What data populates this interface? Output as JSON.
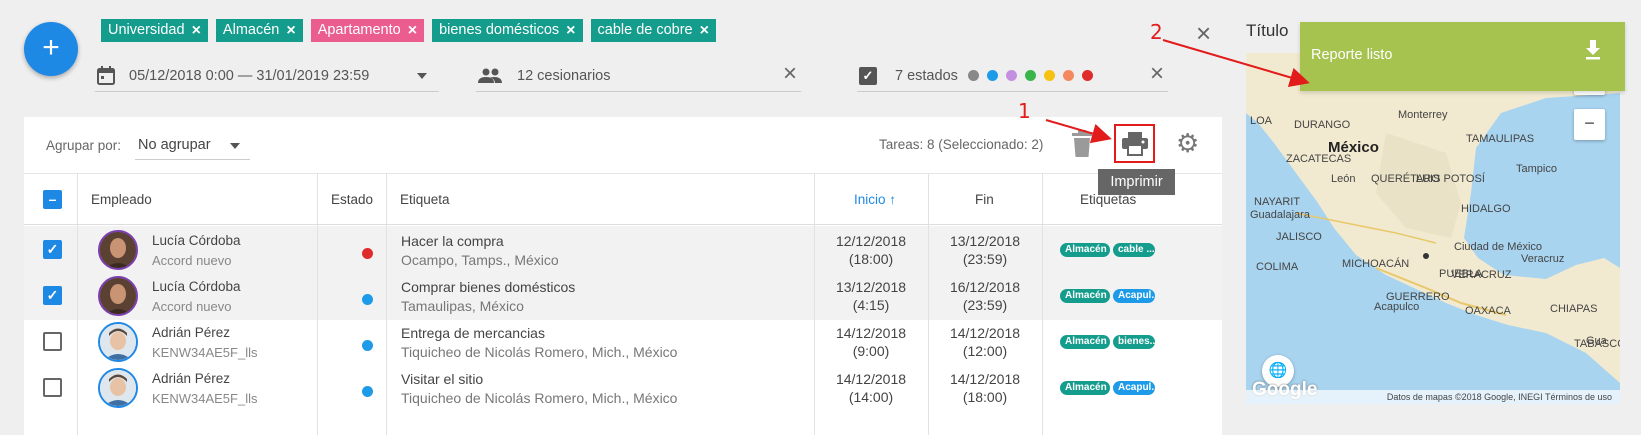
{
  "fab_label": "+",
  "filter_tags": [
    {
      "label": "Universidad",
      "color": "#149c8c"
    },
    {
      "label": "Almacén",
      "color": "#149c8c"
    },
    {
      "label": "Apartamento",
      "color": "#ea5d8e"
    },
    {
      "label": "bienes domésticos",
      "color": "#149c8c"
    },
    {
      "label": "cable de cobre",
      "color": "#149c8c"
    }
  ],
  "filters": {
    "date_range": "05/12/2018 0:00 — 31/01/2019 23:59",
    "assignees": "12 cesionarios",
    "states": "7 estados",
    "state_colors": [
      "#888888",
      "#1e9be8",
      "#c390e0",
      "#39b54a",
      "#f5c213",
      "#f4895f",
      "#e02b2b"
    ]
  },
  "toolbar": {
    "group_label": "Agrupar por:",
    "group_value": "No agrupar",
    "task_count": "Tareas: 8 (Seleccionado: 2)",
    "print_tooltip": "Imprimir"
  },
  "table": {
    "headers": {
      "employee": "Empleado",
      "state": "Estado",
      "label": "Etiqueta",
      "start": "Inicio",
      "end": "Fin",
      "tags": "Etiquetas"
    },
    "rows": [
      {
        "selected": true,
        "avatar": "f",
        "name": "Lucía Córdoba",
        "sub": "Accord nuevo",
        "state_color": "#e02b2b",
        "title": "Hacer la compra",
        "place": "Ocampo, Tamps., México",
        "start_date": "12/12/2018",
        "start_time": "(18:00)",
        "end_date": "13/12/2018",
        "end_time": "(23:59)",
        "chips": [
          {
            "label": "Almacén",
            "color": "#149c8c"
          },
          {
            "label": "cable ...",
            "color": "#149c8c"
          }
        ]
      },
      {
        "selected": true,
        "avatar": "f",
        "name": "Lucía Córdoba",
        "sub": "Accord nuevo",
        "state_color": "#1e9be8",
        "title": "Comprar bienes domésticos",
        "place": "Tamaulipas, México",
        "start_date": "13/12/2018",
        "start_time": "(4:15)",
        "end_date": "16/12/2018",
        "end_time": "(23:59)",
        "chips": [
          {
            "label": "Almacén",
            "color": "#149c8c"
          },
          {
            "label": "Acapul...",
            "color": "#1e9be8"
          }
        ]
      },
      {
        "selected": false,
        "avatar": "m",
        "name": "Adrián Pérez",
        "sub": "KENW34AE5F_lls",
        "state_color": "#1e9be8",
        "title": "Entrega de mercancias",
        "place": "Tiquicheo de Nicolás Romero, Mich., México",
        "start_date": "14/12/2018",
        "start_time": "(9:00)",
        "end_date": "14/12/2018",
        "end_time": "(12:00)",
        "chips": [
          {
            "label": "Almacén",
            "color": "#149c8c"
          },
          {
            "label": "bienes...",
            "color": "#149c8c"
          }
        ]
      },
      {
        "selected": false,
        "avatar": "m",
        "name": "Adrián Pérez",
        "sub": "KENW34AE5F_lls",
        "state_color": "#1e9be8",
        "title": "Visitar el sitio",
        "place": "Tiquicheo de Nicolás Romero, Mich., México",
        "start_date": "14/12/2018",
        "start_time": "(14:00)",
        "end_date": "14/12/2018",
        "end_time": "(18:00)",
        "chips": [
          {
            "label": "Almacén",
            "color": "#149c8c"
          },
          {
            "label": "Acapul...",
            "color": "#1e9be8"
          }
        ]
      }
    ]
  },
  "map": {
    "title": "Título",
    "attribution": "Datos de mapas ©2018 Google, INEGI   Términos de uso",
    "country": "México",
    "google": "Google",
    "zoom_out": "−",
    "labels": [
      "LOA",
      "DURANGO",
      "Monterrey",
      "TAMAULIPAS",
      "NAYARIT",
      "Guadalajara",
      "JALISCO",
      "COLIMA",
      "MICHOACÁN",
      "Ciudad de México",
      "Veracruz",
      "PUEBLA",
      "VERACRUZ",
      "GUERRERO",
      "OAXACA",
      "CHIAPAS",
      "Acapulco",
      "TABASCO",
      "Gua",
      "QUERÉTARO",
      "LUIS POTOSÍ",
      "ZACATECAS",
      "HIDALGO",
      "Tampico",
      "León"
    ]
  },
  "toast": {
    "message": "Reporte listo",
    "color": "#a6c24f"
  },
  "annotations": {
    "one": "1",
    "two": "2",
    "color": "#e21b1b"
  }
}
